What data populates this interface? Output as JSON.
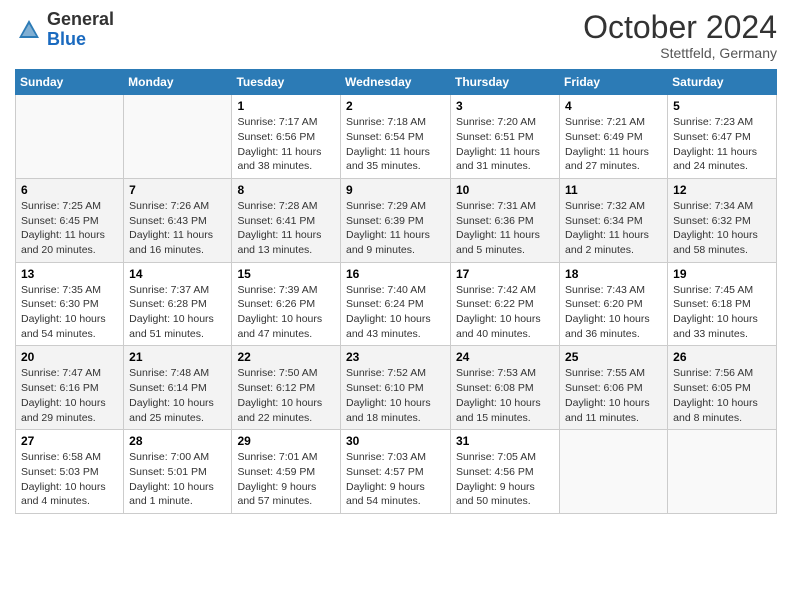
{
  "header": {
    "logo_general": "General",
    "logo_blue": "Blue",
    "month_title": "October 2024",
    "location": "Stettfeld, Germany"
  },
  "weekdays": [
    "Sunday",
    "Monday",
    "Tuesday",
    "Wednesday",
    "Thursday",
    "Friday",
    "Saturday"
  ],
  "weeks": [
    [
      {
        "day": "",
        "info": ""
      },
      {
        "day": "",
        "info": ""
      },
      {
        "day": "1",
        "info": "Sunrise: 7:17 AM\nSunset: 6:56 PM\nDaylight: 11 hours and 38 minutes."
      },
      {
        "day": "2",
        "info": "Sunrise: 7:18 AM\nSunset: 6:54 PM\nDaylight: 11 hours and 35 minutes."
      },
      {
        "day": "3",
        "info": "Sunrise: 7:20 AM\nSunset: 6:51 PM\nDaylight: 11 hours and 31 minutes."
      },
      {
        "day": "4",
        "info": "Sunrise: 7:21 AM\nSunset: 6:49 PM\nDaylight: 11 hours and 27 minutes."
      },
      {
        "day": "5",
        "info": "Sunrise: 7:23 AM\nSunset: 6:47 PM\nDaylight: 11 hours and 24 minutes."
      }
    ],
    [
      {
        "day": "6",
        "info": "Sunrise: 7:25 AM\nSunset: 6:45 PM\nDaylight: 11 hours and 20 minutes."
      },
      {
        "day": "7",
        "info": "Sunrise: 7:26 AM\nSunset: 6:43 PM\nDaylight: 11 hours and 16 minutes."
      },
      {
        "day": "8",
        "info": "Sunrise: 7:28 AM\nSunset: 6:41 PM\nDaylight: 11 hours and 13 minutes."
      },
      {
        "day": "9",
        "info": "Sunrise: 7:29 AM\nSunset: 6:39 PM\nDaylight: 11 hours and 9 minutes."
      },
      {
        "day": "10",
        "info": "Sunrise: 7:31 AM\nSunset: 6:36 PM\nDaylight: 11 hours and 5 minutes."
      },
      {
        "day": "11",
        "info": "Sunrise: 7:32 AM\nSunset: 6:34 PM\nDaylight: 11 hours and 2 minutes."
      },
      {
        "day": "12",
        "info": "Sunrise: 7:34 AM\nSunset: 6:32 PM\nDaylight: 10 hours and 58 minutes."
      }
    ],
    [
      {
        "day": "13",
        "info": "Sunrise: 7:35 AM\nSunset: 6:30 PM\nDaylight: 10 hours and 54 minutes."
      },
      {
        "day": "14",
        "info": "Sunrise: 7:37 AM\nSunset: 6:28 PM\nDaylight: 10 hours and 51 minutes."
      },
      {
        "day": "15",
        "info": "Sunrise: 7:39 AM\nSunset: 6:26 PM\nDaylight: 10 hours and 47 minutes."
      },
      {
        "day": "16",
        "info": "Sunrise: 7:40 AM\nSunset: 6:24 PM\nDaylight: 10 hours and 43 minutes."
      },
      {
        "day": "17",
        "info": "Sunrise: 7:42 AM\nSunset: 6:22 PM\nDaylight: 10 hours and 40 minutes."
      },
      {
        "day": "18",
        "info": "Sunrise: 7:43 AM\nSunset: 6:20 PM\nDaylight: 10 hours and 36 minutes."
      },
      {
        "day": "19",
        "info": "Sunrise: 7:45 AM\nSunset: 6:18 PM\nDaylight: 10 hours and 33 minutes."
      }
    ],
    [
      {
        "day": "20",
        "info": "Sunrise: 7:47 AM\nSunset: 6:16 PM\nDaylight: 10 hours and 29 minutes."
      },
      {
        "day": "21",
        "info": "Sunrise: 7:48 AM\nSunset: 6:14 PM\nDaylight: 10 hours and 25 minutes."
      },
      {
        "day": "22",
        "info": "Sunrise: 7:50 AM\nSunset: 6:12 PM\nDaylight: 10 hours and 22 minutes."
      },
      {
        "day": "23",
        "info": "Sunrise: 7:52 AM\nSunset: 6:10 PM\nDaylight: 10 hours and 18 minutes."
      },
      {
        "day": "24",
        "info": "Sunrise: 7:53 AM\nSunset: 6:08 PM\nDaylight: 10 hours and 15 minutes."
      },
      {
        "day": "25",
        "info": "Sunrise: 7:55 AM\nSunset: 6:06 PM\nDaylight: 10 hours and 11 minutes."
      },
      {
        "day": "26",
        "info": "Sunrise: 7:56 AM\nSunset: 6:05 PM\nDaylight: 10 hours and 8 minutes."
      }
    ],
    [
      {
        "day": "27",
        "info": "Sunrise: 6:58 AM\nSunset: 5:03 PM\nDaylight: 10 hours and 4 minutes."
      },
      {
        "day": "28",
        "info": "Sunrise: 7:00 AM\nSunset: 5:01 PM\nDaylight: 10 hours and 1 minute."
      },
      {
        "day": "29",
        "info": "Sunrise: 7:01 AM\nSunset: 4:59 PM\nDaylight: 9 hours and 57 minutes."
      },
      {
        "day": "30",
        "info": "Sunrise: 7:03 AM\nSunset: 4:57 PM\nDaylight: 9 hours and 54 minutes."
      },
      {
        "day": "31",
        "info": "Sunrise: 7:05 AM\nSunset: 4:56 PM\nDaylight: 9 hours and 50 minutes."
      },
      {
        "day": "",
        "info": ""
      },
      {
        "day": "",
        "info": ""
      }
    ]
  ]
}
